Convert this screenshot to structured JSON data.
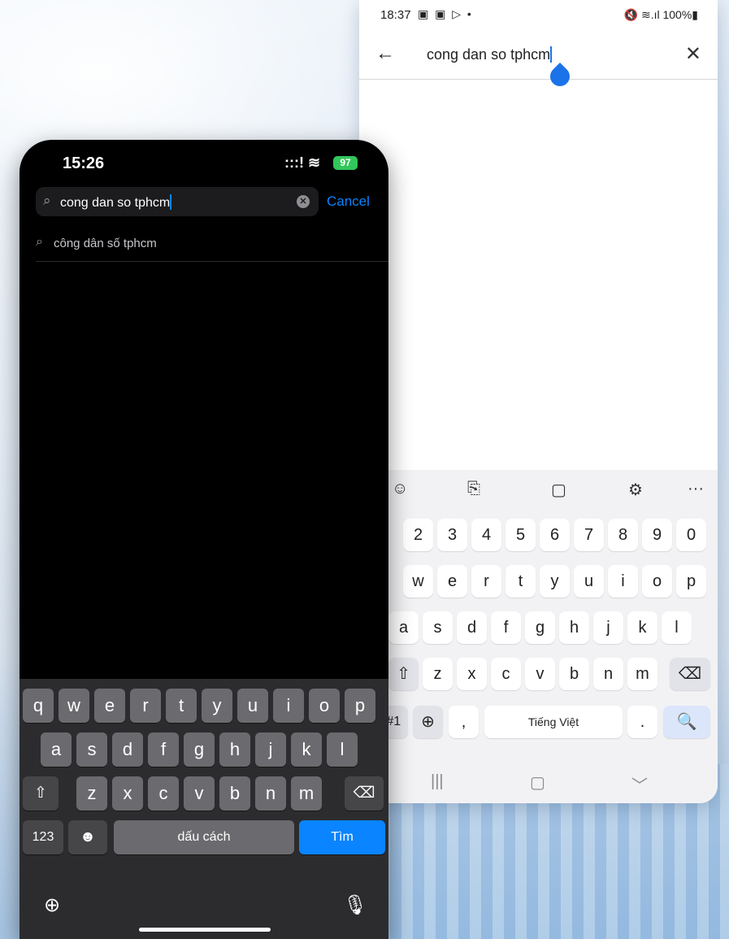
{
  "android": {
    "status": {
      "time": "18:37",
      "notif": "▣ ▣ ▷ •",
      "icons": "🔇 ≋.ıl 100%▮"
    },
    "search": {
      "back_icon": "←",
      "query": "cong dan so tphcm",
      "close_icon": "✕"
    },
    "keyboard": {
      "toolbar": [
        "☺",
        "⎘",
        "▢",
        "⚙",
        "···"
      ],
      "row1": [
        "2",
        "3",
        "4",
        "5",
        "6",
        "7",
        "8",
        "9",
        "0"
      ],
      "row2": [
        "w",
        "e",
        "r",
        "t",
        "y",
        "u",
        "i",
        "o",
        "p"
      ],
      "row3": [
        "a",
        "s",
        "d",
        "f",
        "g",
        "h",
        "j",
        "k",
        "l"
      ],
      "row4": [
        "⇧",
        "z",
        "x",
        "c",
        "v",
        "b",
        "n",
        "m",
        "⌫"
      ],
      "row5": {
        "sym": "!#1",
        "globe": "⊕",
        "comma": ",",
        "space": "Tiếng Việt",
        "period": ".",
        "search": "🔍"
      }
    },
    "nav": [
      "|||",
      "▢",
      "﹀"
    ]
  },
  "iphone": {
    "status": {
      "time": "15:26",
      "signal": ":::! ≋",
      "battery": "97"
    },
    "search": {
      "query": "cong dan so tphcm",
      "cancel": "Cancel",
      "mag_icon": "⌕",
      "clear_icon": "✕"
    },
    "suggestion": "công dân số tphcm",
    "keyboard": {
      "row1": [
        "q",
        "w",
        "e",
        "r",
        "t",
        "y",
        "u",
        "i",
        "o",
        "p"
      ],
      "row2": [
        "a",
        "s",
        "d",
        "f",
        "g",
        "h",
        "j",
        "k",
        "l"
      ],
      "row3": [
        "z",
        "x",
        "c",
        "v",
        "b",
        "n",
        "m"
      ],
      "shift": "⇧",
      "delete": "⌫",
      "num": "123",
      "emoji": "☻",
      "space": "dấu cách",
      "go": "Tìm",
      "globe": "⊕",
      "mic": "🎙"
    }
  }
}
